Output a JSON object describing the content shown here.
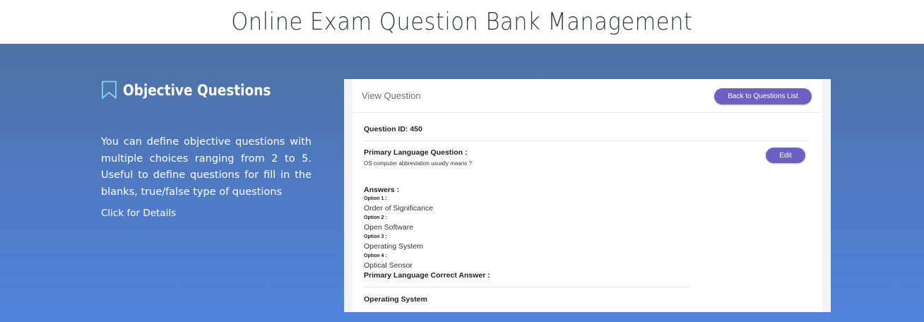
{
  "page": {
    "title": "Online Exam Question Bank Management"
  },
  "feature": {
    "icon": "bookmark-icon",
    "title": "Objective Questions",
    "description": "You can define objective questions with multiple choices ranging from 2 to 5. Useful to define questions for fill in the blanks, true/false type of questions",
    "link_label": "Click for Details"
  },
  "view_question": {
    "header_title": "View Question",
    "back_button_label": "Back to Questions List",
    "question_id_label": "Question ID:",
    "question_id_value": "450",
    "primary_question_label": "Primary Language Question :",
    "primary_question_text": "OS computer abbreviation usually means ?",
    "edit_button_label": "Edit",
    "answers_label": "Answers :",
    "options": [
      {
        "label": "Option 1 :",
        "value": "Order of Significance"
      },
      {
        "label": "Option 2 :",
        "value": "Open Software"
      },
      {
        "label": "Option 3 :",
        "value": "Operating System"
      },
      {
        "label": "Option 4 :",
        "value": "Optical Sensor"
      }
    ],
    "correct_answer_label": "Primary Language Correct Answer :",
    "correct_answer_value": "Operating System"
  },
  "colors": {
    "gradient_top": "#4d71a3",
    "gradient_bottom": "#5184db",
    "button_accent": "#6d5fc4"
  }
}
